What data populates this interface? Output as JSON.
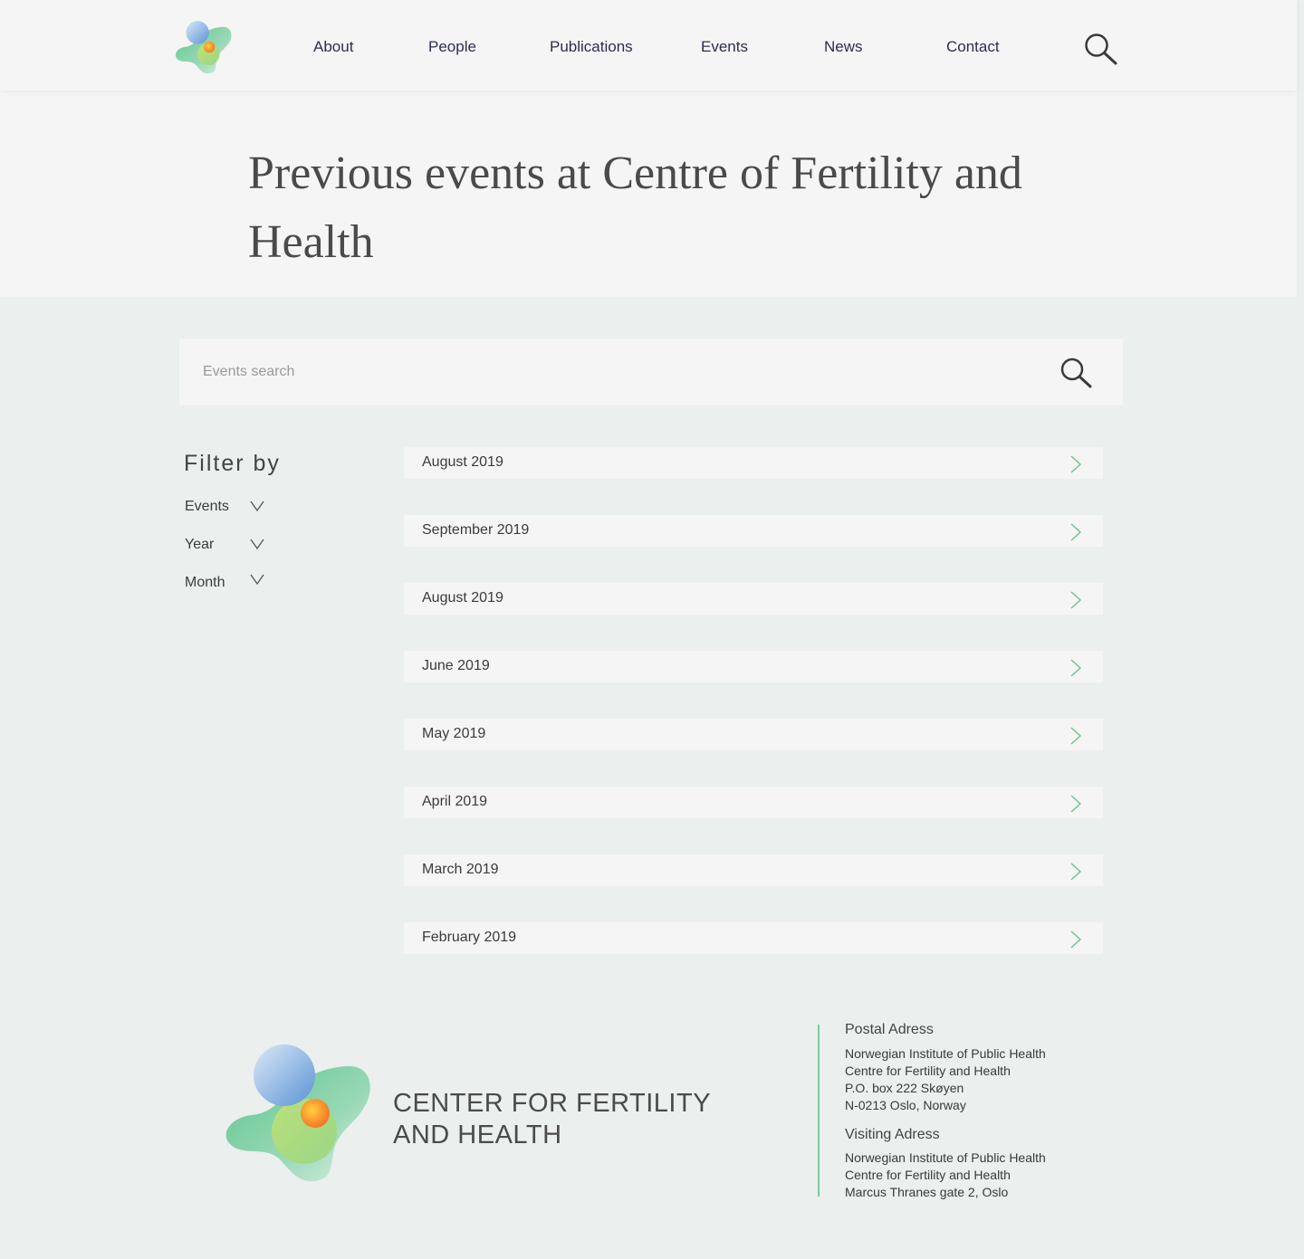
{
  "nav": {
    "items": [
      {
        "label": "About"
      },
      {
        "label": "People"
      },
      {
        "label": "Publications"
      },
      {
        "label": "Events"
      },
      {
        "label": "News"
      },
      {
        "label": "Contact"
      }
    ]
  },
  "hero": {
    "title": "Previous events at Centre of Fertility and Health"
  },
  "search": {
    "placeholder": "Events search"
  },
  "filter": {
    "title": "Filter by",
    "items": [
      {
        "label": "Events"
      },
      {
        "label": "Year"
      },
      {
        "label": "Month"
      }
    ]
  },
  "events": [
    {
      "label": "August 2019"
    },
    {
      "label": "September 2019"
    },
    {
      "label": "August 2019"
    },
    {
      "label": "June 2019"
    },
    {
      "label": "May 2019"
    },
    {
      "label": "April 2019"
    },
    {
      "label": "March 2019"
    },
    {
      "label": "February 2019"
    }
  ],
  "footer": {
    "name_line1": "CENTER FOR FERTILITY",
    "name_line2": "AND HEALTH",
    "postal": {
      "heading": "Postal Adress",
      "lines": [
        "Norwegian Institute of Public Health",
        "Centre for Fertility and Health",
        "P.O. box 222 Skøyen",
        "N-0213 Oslo, Norway"
      ]
    },
    "visiting": {
      "heading": "Visiting Adress",
      "lines": [
        "Norwegian Institute of Public Health",
        "Centre for Fertility and Health",
        "Marcus Thranes gate 2, Oslo"
      ]
    }
  },
  "colors": {
    "background": "#ebefee",
    "panel": "#f5f5f5",
    "nav_text": "#2d2f4a",
    "accent_green": "#7fcb9a"
  }
}
